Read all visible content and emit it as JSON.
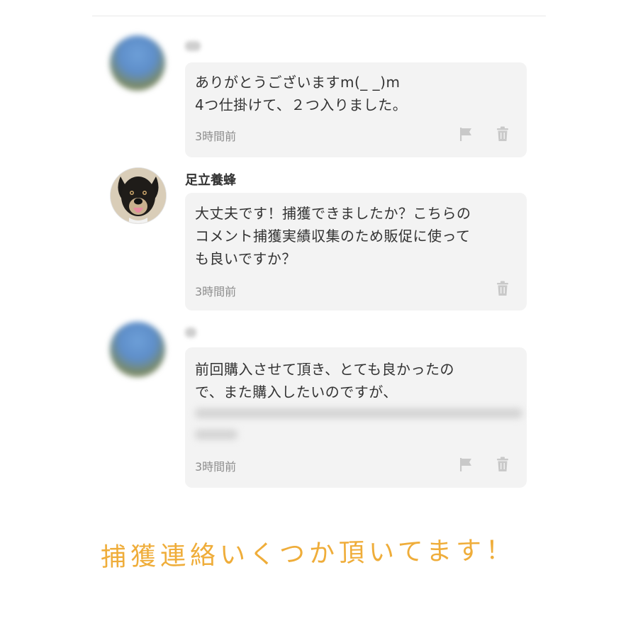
{
  "comments": [
    {
      "author": "",
      "body": "ありがとうございますm(_ _)m\n4つ仕掛けて、２つ入りました。",
      "timestamp": "3時間前",
      "icons": [
        "flag-icon",
        "trash-icon"
      ]
    },
    {
      "author": "足立養蜂",
      "body": "大丈夫です！捕獲できましたか？こちらの\nコメント捕獲実績収集のため販促に使って\nも良いですか？",
      "timestamp": "3時間前",
      "icons": [
        "trash-icon"
      ]
    },
    {
      "author": "",
      "body": "前回購入させて頂き、とても良かったの\nで、また購入したいのですが、",
      "timestamp": "3時間前",
      "icons": [
        "flag-icon",
        "trash-icon"
      ]
    }
  ],
  "caption": "捕獲連絡いくつか頂いてます！",
  "colors": {
    "bubble": "#f3f3f3",
    "text": "#333333",
    "timestamp": "#8d8d8d",
    "icon": "#c9c9c9",
    "caption": "#efad3a"
  }
}
